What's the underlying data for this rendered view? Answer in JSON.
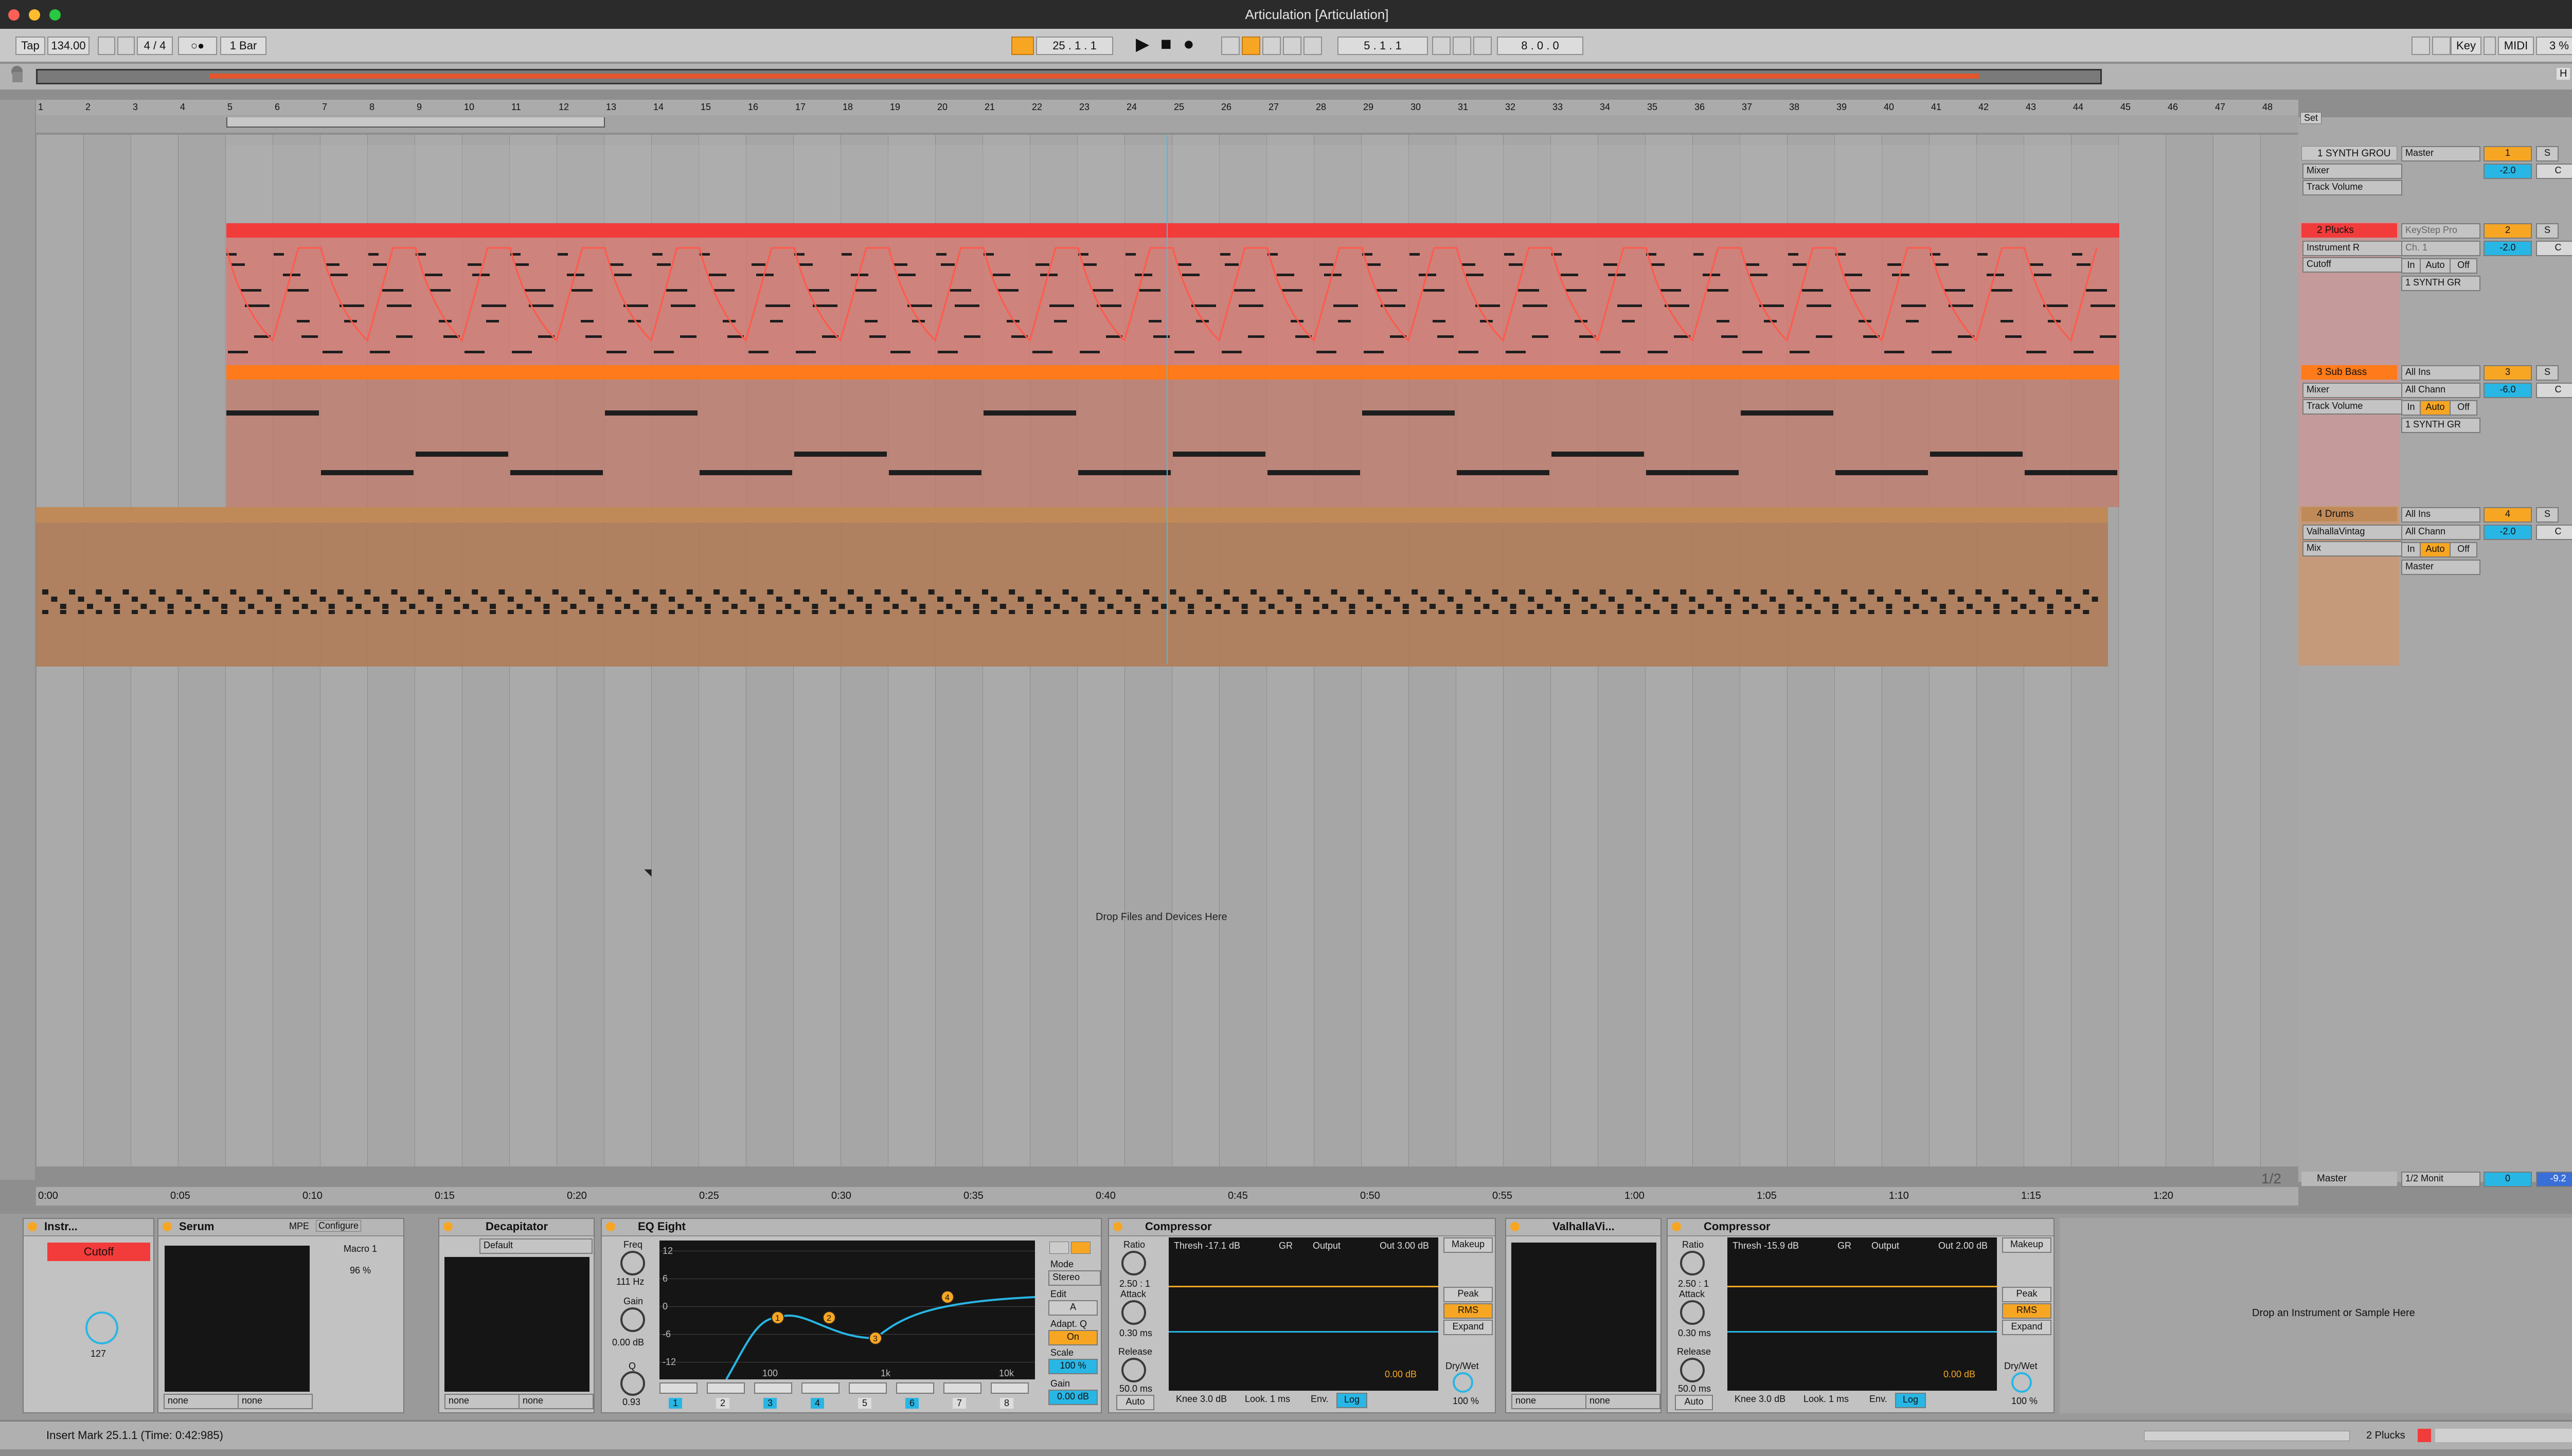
{
  "window": {
    "title": "Articulation  [Articulation]",
    "traffic": [
      "#fe5f57",
      "#febc2e",
      "#28c840"
    ]
  },
  "transport": {
    "tap_label": "Tap",
    "tempo": "134.00",
    "meter": "4 / 4",
    "quantize": "1 Bar",
    "position": "25 .  1 .  1",
    "loop_start": "5 .  1 .  1",
    "loop_length": "8 .  0 .  0",
    "key_label": "Key",
    "midi_label": "MIDI",
    "cpu": "3 %"
  },
  "ruler": {
    "bars": [
      "1",
      "2",
      "3",
      "4",
      "5",
      "6",
      "7",
      "8",
      "9",
      "10",
      "11",
      "12",
      "13",
      "14",
      "15",
      "16",
      "17",
      "18",
      "19",
      "20",
      "21",
      "22",
      "23",
      "24",
      "25",
      "26",
      "27",
      "28",
      "29",
      "30",
      "31",
      "32",
      "33",
      "34",
      "35",
      "36",
      "37",
      "38",
      "39",
      "40",
      "41",
      "42",
      "43",
      "44",
      "45",
      "46",
      "47",
      "48"
    ],
    "set_label": "Set"
  },
  "time_ruler": {
    "labels": [
      "0:00",
      "0:05",
      "0:10",
      "0:15",
      "0:20",
      "0:25",
      "0:30",
      "0:35",
      "0:40",
      "0:45",
      "0:50",
      "0:55",
      "1:00",
      "1:05",
      "1:10",
      "1:15",
      "1:20"
    ],
    "zoom": "1/2"
  },
  "tracks": [
    {
      "name": "1 SYNTH GROU",
      "output": "Master",
      "device": "Mixer",
      "param": "Track Volume",
      "number": "1",
      "volume": "-2.0",
      "pan": "C",
      "solo": "S",
      "color": "#9a9a9a"
    },
    {
      "name": "2 Plucks",
      "input": "KeyStep Pro",
      "channel": "Ch. 1",
      "device": "Instrument R",
      "param": "Cutoff",
      "monitor": [
        "In",
        "Auto",
        "Off"
      ],
      "output": "1 SYNTH GR",
      "number": "2",
      "volume": "-2.0",
      "pan": "C",
      "solo": "S",
      "color": "#f23b3b"
    },
    {
      "name": "3 Sub Bass",
      "input": "All Ins",
      "channel": "All Chann",
      "device": "Mixer",
      "param": "Track Volume",
      "monitor": [
        "In",
        "Auto",
        "Off"
      ],
      "output": "1 SYNTH GR",
      "number": "3",
      "volume": "-6.0",
      "pan": "C",
      "solo": "S",
      "color": "#ff7a1a"
    },
    {
      "name": "4 Drums",
      "input": "All Ins",
      "channel": "All Chann",
      "device": "ValhallaVintag",
      "param": "Mix",
      "monitor": [
        "In",
        "Auto",
        "Off"
      ],
      "output": "Master",
      "number": "4",
      "volume": "-2.0",
      "pan": "C",
      "solo": "S",
      "color": "#c08a58"
    }
  ],
  "master": {
    "name": "Master",
    "output": "1/2 Monit",
    "volume": "0",
    "pan_value": "-9.2"
  },
  "drop_files": "Drop Files and Devices Here",
  "devices": {
    "instrument_rack": {
      "title": "Instr...",
      "macro_name": "Cutoff",
      "macro_value": "127"
    },
    "serum": {
      "title": "Serum",
      "mpe": "MPE",
      "configure": "Configure",
      "macro": "Macro 1",
      "macro_value": "96 %",
      "menus": [
        "none",
        "none"
      ]
    },
    "decapitator": {
      "title": "Decapitator",
      "preset": "Default",
      "menus": [
        "none",
        "none"
      ]
    },
    "eq_eight": {
      "title": "EQ Eight",
      "freq_label": "Freq",
      "freq_value": "111 Hz",
      "gain_label": "Gain",
      "gain_value": "0.00 dB",
      "q_label": "Q",
      "q_value": "0.93",
      "db_ticks": [
        "12",
        "6",
        "0",
        "-6",
        "-12"
      ],
      "freq_ticks": [
        "100",
        "1k",
        "10k"
      ],
      "mode_label": "Mode",
      "mode_value": "Stereo",
      "edit_label": "Edit",
      "edit_value": "A",
      "adapt_label": "Adapt. Q",
      "adapt_value": "On",
      "scale_label": "Scale",
      "scale_value": "100 %",
      "out_gain_label": "Gain",
      "out_gain_value": "0.00 dB",
      "bands": [
        "1",
        "2",
        "3",
        "4",
        "5",
        "6",
        "7",
        "8"
      ],
      "points": [
        "1",
        "2",
        "3",
        "4"
      ]
    },
    "compressors": [
      {
        "title": "Compressor",
        "ratio_label": "Ratio",
        "ratio_value": "2.50 : 1",
        "attack_label": "Attack",
        "attack_value": "0.30 ms",
        "release_label": "Release",
        "release_value": "50.0 ms",
        "auto_label": "Auto",
        "thresh": "Thresh -17.1 dB",
        "gr": "GR",
        "output": "Output",
        "out": "Out 3.00 dB",
        "readout": "0.00 dB",
        "makeup": "Makeup",
        "peak": "Peak",
        "rms": "RMS",
        "expand": "Expand",
        "drywet_label": "Dry/Wet",
        "drywet_value": "100 %",
        "knee": "Knee 3.0 dB",
        "look": "Look. 1 ms",
        "env": "Env.",
        "log": "Log"
      },
      {
        "title": "Compressor",
        "ratio_label": "Ratio",
        "ratio_value": "2.50 : 1",
        "attack_label": "Attack",
        "attack_value": "0.30 ms",
        "release_label": "Release",
        "release_value": "50.0 ms",
        "auto_label": "Auto",
        "thresh": "Thresh -15.9 dB",
        "gr": "GR",
        "output": "Output",
        "out": "Out 2.00 dB",
        "readout": "0.00 dB",
        "makeup": "Makeup",
        "peak": "Peak",
        "rms": "RMS",
        "expand": "Expand",
        "drywet_label": "Dry/Wet",
        "drywet_value": "100 %",
        "knee": "Knee 3.0 dB",
        "look": "Look. 1 ms",
        "env": "Env.",
        "log": "Log"
      }
    ],
    "valhalla": {
      "title": "ValhallaVi...",
      "menus": [
        "none",
        "none"
      ]
    },
    "drop_instrument": "Drop an Instrument or Sample Here"
  },
  "status": {
    "message": "Insert Mark 25.1.1 (Time: 0:42:985)",
    "track": "2 Plucks"
  },
  "colors": {
    "accent": "#f7a623",
    "blue": "#28b6e4",
    "plucks": "#f23b3b",
    "subbass": "#ff7a1a",
    "drums": "#c08a58"
  }
}
